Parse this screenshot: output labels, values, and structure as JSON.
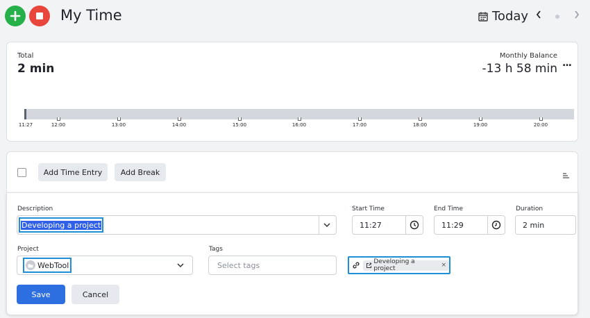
{
  "header": {
    "title": "My Time",
    "today_label": "Today"
  },
  "summary": {
    "total_label": "Total",
    "total_value": "2 min",
    "balance_label": "Monthly Balance",
    "balance_value": "-13 h 58 min",
    "more_label": "..."
  },
  "timeline": {
    "ticks": [
      "11:27",
      "12:00",
      "13:00",
      "14:00",
      "15:00",
      "16:00",
      "17:00",
      "18:00",
      "19:00",
      "20:00"
    ]
  },
  "toolbar": {
    "add_entry_label": "Add Time Entry",
    "add_break_label": "Add Break"
  },
  "entry_form": {
    "description_label": "Description",
    "description_value": "Developing a project",
    "start_time_label": "Start Time",
    "start_time_value": "11:27",
    "end_time_label": "End Time",
    "end_time_value": "11:29",
    "duration_label": "Duration",
    "duration_value": "2 min",
    "project_label": "Project",
    "project_value": "WebTool",
    "tags_label": "Tags",
    "tags_placeholder": "Select tags",
    "linked_chip_label": "Developing a project",
    "save_label": "Save",
    "cancel_label": "Cancel"
  },
  "colors": {
    "add_button": "#25b04a",
    "stop_button": "#e8453c",
    "save_button": "#2d6fe0",
    "highlight": "#1e8fd6"
  }
}
